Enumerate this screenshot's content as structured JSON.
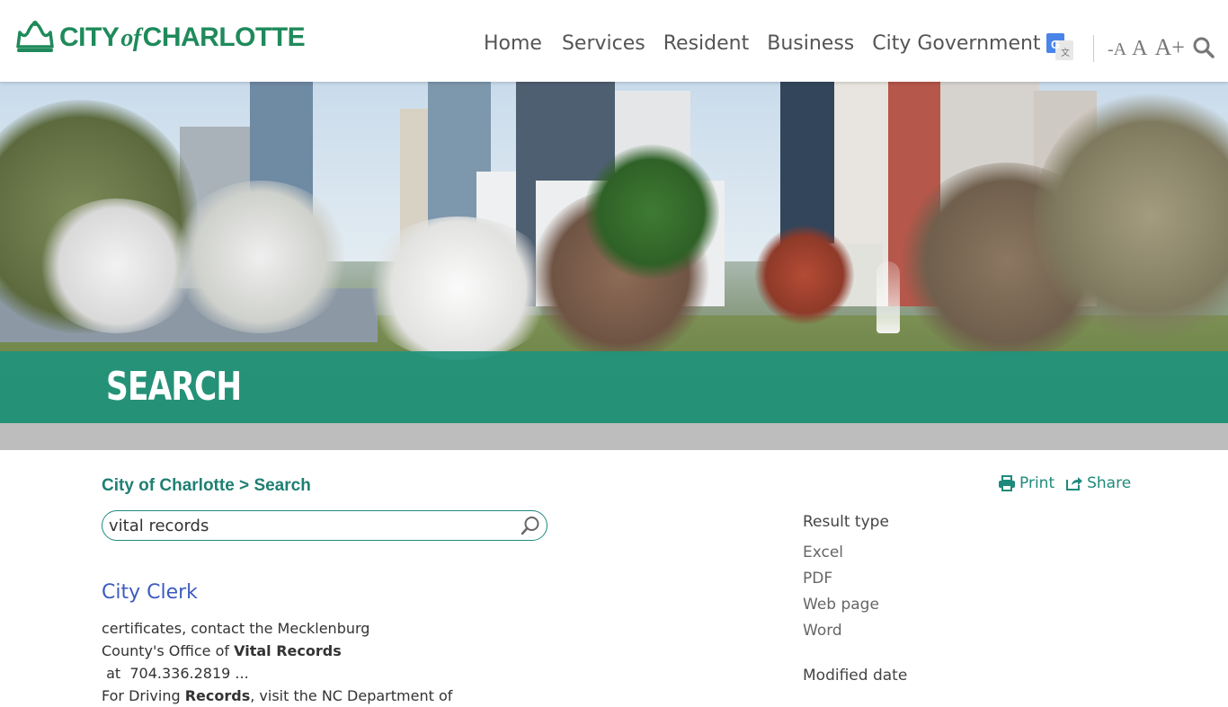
{
  "header": {
    "logo": {
      "text_city": "CITY",
      "text_of": "of",
      "text_name": "CHARLOTTE"
    },
    "nav": [
      {
        "label": "Home"
      },
      {
        "label": "Services"
      },
      {
        "label": "Resident"
      },
      {
        "label": "Business"
      },
      {
        "label": "City Government"
      }
    ],
    "font_size_controls": {
      "decrease": "-A",
      "reset": "A",
      "increase": "A+"
    },
    "icons": [
      "google-translate-icon",
      "search-icon"
    ]
  },
  "hero": {
    "title": "SEARCH"
  },
  "breadcrumb": {
    "home": "City of Charlotte",
    "separator": " > ",
    "current": "Search"
  },
  "actions": {
    "print_label": "Print",
    "share_label": "Share"
  },
  "search": {
    "value": "vital records"
  },
  "results": [
    {
      "title": "City Clerk",
      "snippet_lines": [
        {
          "parts": [
            {
              "text": "certificates, contact the Mecklenburg",
              "bold": false
            }
          ]
        },
        {
          "parts": [
            {
              "text": "County's Office of ",
              "bold": false
            },
            {
              "text": "Vital Records",
              "bold": true
            },
            {
              "text": " at  704.336.2819 ...",
              "bold": false
            }
          ]
        },
        {
          "parts": [
            {
              "text": "For Driving ",
              "bold": false
            },
            {
              "text": "Records",
              "bold": true
            },
            {
              "text": ", visit the NC Department of",
              "bold": false
            }
          ]
        }
      ]
    }
  ],
  "facets": {
    "result_type": {
      "heading": "Result type",
      "items": [
        "Excel",
        "PDF",
        "Web page",
        "Word"
      ]
    },
    "modified_date": {
      "heading": "Modified date"
    }
  },
  "colors": {
    "brand_green": "#1f8a5b",
    "teal": "#1f8a7c",
    "banner": "#20947c",
    "link_blue": "#3d5bbf"
  }
}
